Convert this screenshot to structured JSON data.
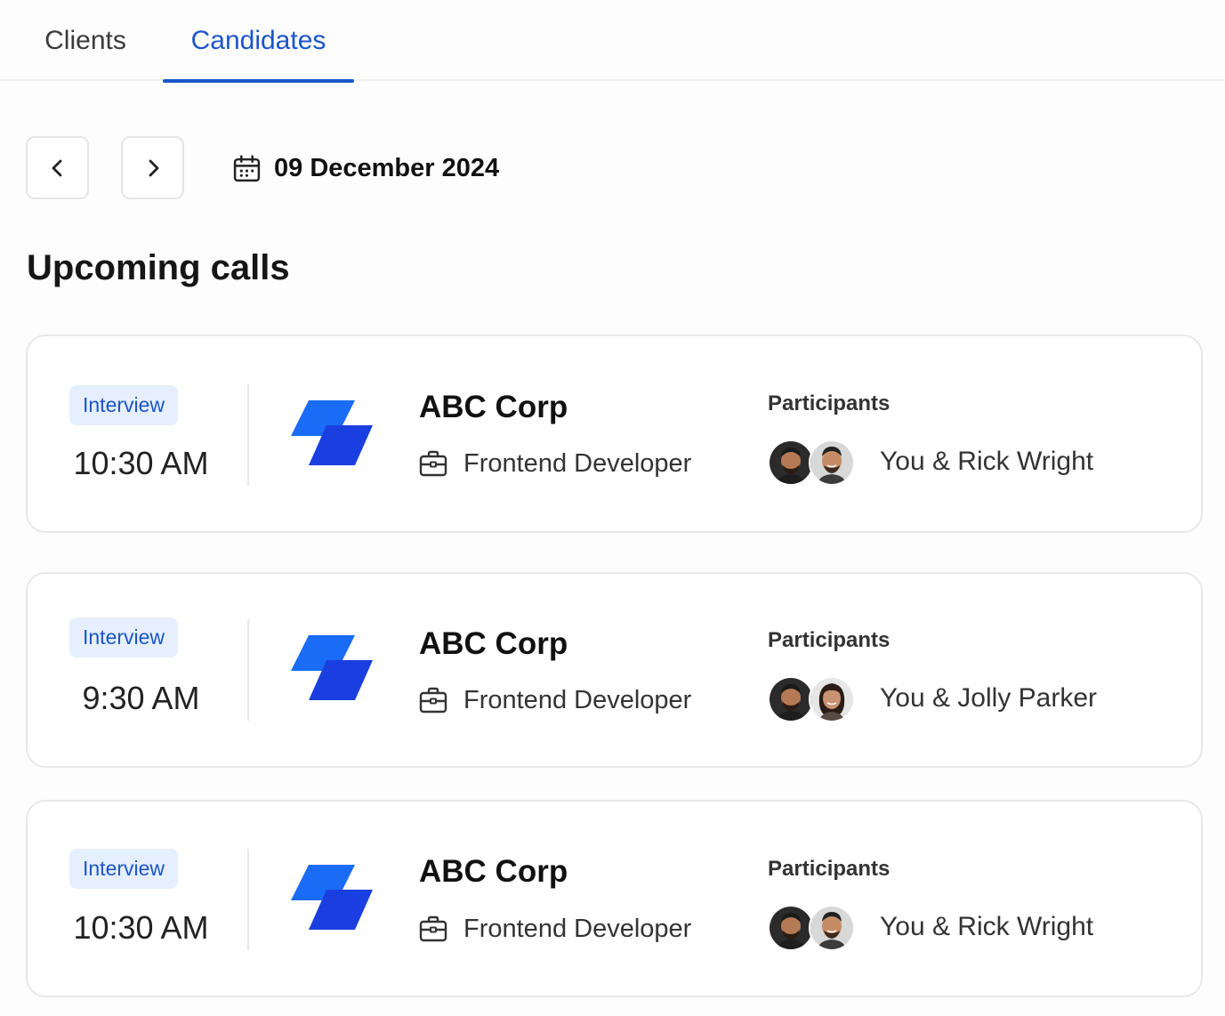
{
  "tabs": [
    {
      "label": "Clients",
      "active": false
    },
    {
      "label": "Candidates",
      "active": true
    }
  ],
  "date_nav": {
    "prev_icon": "chevron-left-icon",
    "next_icon": "chevron-right-icon",
    "calendar_icon": "calendar-icon",
    "date": "09 December 2024"
  },
  "section_title": "Upcoming calls",
  "colors": {
    "accent": "#1b55c9",
    "badge_bg": "#e5effd",
    "logo_light": "#1a6bf5",
    "logo_dark": "#1a3fe0"
  },
  "calls": [
    {
      "badge": "Interview",
      "time": "10:30 AM",
      "company": "ABC Corp",
      "role": "Frontend Developer",
      "role_icon": "briefcase-icon",
      "participants_label": "Participants",
      "participants": "You & Rick Wright",
      "avatars": [
        "avatar-man-beard",
        "avatar-man-smiling"
      ]
    },
    {
      "badge": "Interview",
      "time": "9:30 AM",
      "company": "ABC Corp",
      "role": "Frontend Developer",
      "role_icon": "briefcase-icon",
      "participants_label": "Participants",
      "participants": "You & Jolly Parker",
      "avatars": [
        "avatar-man-beard",
        "avatar-woman"
      ]
    },
    {
      "badge": "Interview",
      "time": "10:30 AM",
      "company": "ABC Corp",
      "role": "Frontend Developer",
      "role_icon": "briefcase-icon",
      "participants_label": "Participants",
      "participants": "You & Rick Wright",
      "avatars": [
        "avatar-man-beard",
        "avatar-man-smiling"
      ]
    }
  ]
}
